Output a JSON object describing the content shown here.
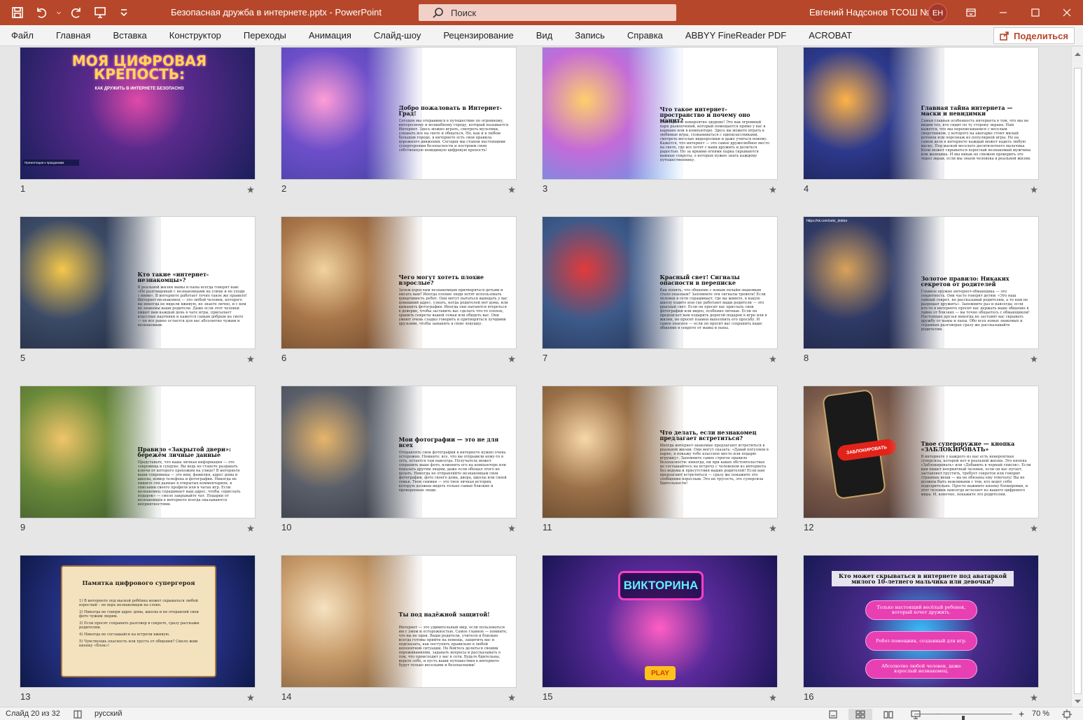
{
  "titlebar": {
    "doc_title": "Безопасная дружба в интернете.pptx  -  PowerPoint",
    "search_placeholder": "Поиск",
    "user_name": "Евгений Надсонов ТСОШ №2",
    "user_initials": "ЕН"
  },
  "ribbon": {
    "tabs": [
      "Файл",
      "Главная",
      "Вставка",
      "Конструктор",
      "Переходы",
      "Анимация",
      "Слайд-шоу",
      "Рецензирование",
      "Вид",
      "Запись",
      "Справка",
      "ABBYY FineReader PDF",
      "ACROBAT"
    ],
    "share_label": "Поделиться"
  },
  "slides": [
    {
      "num": "1",
      "kind": "cover",
      "title": "МОЯ ЦИФРОВАЯ КРЕПОСТЬ:",
      "subtitle": "КАК ДРУЖИТЬ В ИНТЕРНЕТЕ БЕЗОПАСНО",
      "footer": "Презентации к праздникам",
      "palette": [
        "#1b1f5c",
        "#5a2a8c",
        "#e04aa8"
      ]
    },
    {
      "num": "2",
      "kind": "text",
      "title": "Добро пожаловать в Интернет-Град!",
      "body": "Сегодня мы отправимся в путешествие по огромному, интересному и волшебному городу, который называется Интернет. Здесь можно играть, смотреть мультики, узнавать все на свете и общаться. Но, как и в любом большом городе, в интернете есть свои правила дорожного движения. Сегодня мы станем настоящими супергероями безопасности и построим свою собственную невидимую цифровую крепость!",
      "palette": [
        "#3a3f9a",
        "#6d4fc9",
        "#ff9dd6"
      ]
    },
    {
      "num": "3",
      "kind": "text",
      "title": "Что такое интернет-пространство и почему оно манит?",
      "body": "В интернете невероятно здорово! Это как огромный парк развлечений, который помещается прямо у вас в кармане или в компьютере. Здесь вы можете играть в любимые игры, созваниваться с одноклассниками, смотреть веселые видеоролики и даже учиться новому. Кажется, что интернет — это самое дружелюбное место на свете, где все хотят с вами дружить и делиться радостью. Но за яркими огнями парка скрываются важные секреты, о которых нужно знать каждому путешественнику.",
      "palette": [
        "#4aa3e8",
        "#c46bd8",
        "#ffcf6b"
      ]
    },
    {
      "num": "4",
      "kind": "text",
      "title": "Главная тайна интернета — маски и невидимки",
      "body": "Самая главная особенность интернета в том, что мы не видим тех, кто сидит по ту сторону экрана. Нам кажется, что мы переписываемся с веселым сверстником, у которого на аватарке стоит милый котенок или персонаж из популярной игры. Но на самом деле в интернете каждый может надеть любую маску. Под маской веселого десятилетнего мальчика Коли может скрываться взрослый незнакомый мужчина или женщина. И мы никак не сможем проверить это через экран, если мы знаем человека в реальной жизни.",
      "palette": [
        "#14183f",
        "#2d3a8c",
        "#ffb347"
      ]
    },
    {
      "num": "5",
      "kind": "text",
      "title": "Кто такие «интернет-незнакомцы»?",
      "body": "В реальной жизни мамы и папы всегда говорят нам: «Не разговаривай с незнакомцами на улице и не уходи с ними». В интернете работает точно такое же правило! Интернет-незнакомец — это любой человек, которого вы никогда не видели вживую, не знаете лично, и с кем не знакомы ваши родители. Даже если этот человек пишет вам каждый день в чате игры, присылает классные картинки и кажется самым добрым на свете — он все равно остается для вас абсолютно чужим и незнакомым.",
      "palette": [
        "#1c2333",
        "#3b4a66",
        "#f5c84a"
      ]
    },
    {
      "num": "6",
      "kind": "text",
      "title": "Чего могут хотеть плохие взрослые?",
      "body": "Зачем взрослым незнакомцам притворяться детьми и писать вам? Иногда плохие люди хотят использовать доверчивость ребят. Они могут пытаться выведать у вас домашний адрес, узнать, когда родителей нет дома, или выманить фотографии. Иногда они пытаются втереться в доверие, чтобы заставить вас сделать что-то плохое, хранить секреты вашей семьи или обидеть вас. Они умеют очень сладко говорить и притворяться лучшими друзьями, чтобы заманить в свою ловушку.",
      "palette": [
        "#5a3a22",
        "#a8764a",
        "#f2d2a0"
      ]
    },
    {
      "num": "7",
      "kind": "text",
      "title": "Красный свет! Сигналы опасности в переписке",
      "body": "Как понять, что общение с новым онлайн-знакомым стало опасным? Запомните эти сигналы тревоги! Если человек в сети спрашивает, где вы живете, в какую школу ходите или где работают ваши родители — это красный свет. Если он просит вас прислать свои фотографии или видео, особенно личные. Если он предлагает вам подарить дорогой подарок в игре или в жизни, но просит взамен выполнить его просьбу. И самое опасное — если он просит вас сохранить ваше общение в секрете от мамы и папы.",
      "palette": [
        "#1e2a4a",
        "#3d5a8a",
        "#e23a3a"
      ]
    },
    {
      "num": "8",
      "kind": "text",
      "title": "Золотое правило: Никаких секретов от родителей",
      "body": "Главное оружие интернет-обманщика — это секретность. Они часто говорят детям: «Это наш тайный секрет, не рассказывай родителям, а то нам не разрешат дружить». Запомните раз и навсегда: если кто-то в интернете просит вас держать ваше общение в тайне от близких — вы точно общаетесь с обманщиком! Настоящие друзья никогда не заставят вас скрывать дружбу от мамы и папы. Обо всех новых знакомых и странных разговорах сразу же рассказывайте родителям.",
      "url": "https://vk.com/sekr_doktor",
      "palette": [
        "#1a1f3a",
        "#2f3a66",
        "#d9a35a"
      ]
    },
    {
      "num": "9",
      "kind": "text",
      "title": "Правило «Закрытой двери»: бережём личные данные",
      "body": "Представьте, что ваша личная информация — это сокровища в сундуке. Вы ведь не станете раздавать ключи от которого прохожим на улице? В интернете ваши сокровища — это имя, фамилия, адрес дома и школы, номер телефона и фотографии. Никогда не пишите эти данные в открытых комментариях, в описании своего профиля или в чатах игр. Если незнакомец спрашивает ваш адрес, чтобы «прислать подарок» — смело закрывайте чат. Подарки от незнакомцев в интернете всегда оказываются неприятностями.",
      "palette": [
        "#2f4a2a",
        "#6b8a3a",
        "#f0c46a"
      ]
    },
    {
      "num": "10",
      "kind": "text",
      "title": "Мои фотографии — это не для всех",
      "body": "Отправлять свои фотографии в интернете нужно очень осторожно. Помните: все, что вы отправили кому-то в сеть, остается там навсегда. Получатель может сохранить ваше фото, изменить его на компьютере или показать другим людям, даже если обещал этого не делать. Никогда не отправляйте незнакомцам свои фотографии, фото своего дома, двора, школы или своей семьи. Твои снимки — это твоя личная история, которую должны видеть только самые близкие и проверенные люди.",
      "palette": [
        "#2a2f3a",
        "#5a5f6a",
        "#e7b56a"
      ]
    },
    {
      "num": "11",
      "kind": "text",
      "title": "Что делать, если незнакомец предлагает встретиться?",
      "body": "Иногда интернет-знакомые предлагают встретиться в реальной жизни. Они могут сказать: «Давай погуляем в парке, я покажу тебе классное место или подарю игрушку». Запомните самое строгое правило безопасности: никогда, ни при каких обстоятельствах не соглашайтесь на встречу с человеком из интернета без ведома и присутствия ваших родителей! Если вам предлагают встретиться — сразу же покажите это сообщение взрослым. Это не трусость, это суперсила бдительности!",
      "palette": [
        "#4a3422",
        "#9a7048",
        "#f7d7a8"
      ]
    },
    {
      "num": "12",
      "kind": "phone",
      "title": "Твое супероружие — кнопка «ЗАБЛОКИРОВАТЬ»",
      "body": "В интернете у каждого из нас есть невероятная суперсила, которой нет в реальной жизни. Это кнопка «Заблокировать» или «Добавить в черный список». Если вам пишет неприятный человек, если он вас пугает, заставляет грустить, требует секретов или говорит странные вещи — вы не обязаны ему отвечать! Вы не должны быть вежливыми с тем, кто ведет себя подозрительно. Просто нажмите кнопку блокировки, и этот человек навсегда исчезнет из вашего цифрового мира. И, конечно, покажите это родителям.",
      "button": "ЗАБЛОКИРОВАТЬ",
      "palette": [
        "#3a2a2a",
        "#7a5a4a",
        "#c8a07a"
      ]
    },
    {
      "num": "13",
      "kind": "memo",
      "title": "Памятка цифрового супергероя",
      "items": [
        "1) В интернете под маской ребёнка может скрываться любой взрослый – не верь незнакомцам на слово.",
        "2) Никогда не говори адрес дома, школы и не отправляй свои фото чужим людям.",
        "3) Если просят сохранить разговор в секрете, сразу расскажи родителям.",
        "4) Никогда не соглашайся на встречи вживую.",
        "5) Чувствуешь опасность или грусть от общения? Смело жми кнопку «Блок»!"
      ],
      "palette": [
        "#0f1a4a",
        "#2f3a9a",
        "#5fe0ff"
      ]
    },
    {
      "num": "14",
      "kind": "text",
      "title": "Ты под надёжной защитой!",
      "body": "Интернет — это удивительный мир, если пользоваться им с умом и осторожностью. Самое главное — помните, что вы не одни. Ваши родители, учителя и близкие всегда готовы прийти на помощь, защитить вас и подсказать, как поступить правильно в любой непонятной ситуации. Не бойтесь делиться своими переживаниями, задавать вопросы и рассказывать о том, что происходит у вас в сети. Будьте бдительны, верьте себе, и пусть ваши путешествия в интернете будут только веселыми и безопасными!",
      "palette": [
        "#6a4a2a",
        "#c79a6a",
        "#f5e2c0"
      ]
    },
    {
      "num": "15",
      "kind": "quiz",
      "title": "ВИКТОРИНА",
      "play": "PLAY",
      "palette": [
        "#1a1555",
        "#5a2a9a",
        "#ff5ec4"
      ]
    },
    {
      "num": "16",
      "kind": "question",
      "title": "Кто может скрываться в интернете под аватаркой милого 10-летнего мальчика или девочки?",
      "options": [
        "Только настоящий весёлый ребенок, который хочет дружить.",
        "Робот-помощник, созданный для игр.",
        "Абсолютно любой человек, даже взрослый незнакомец."
      ],
      "palette": [
        "#171a55",
        "#4a2a8a",
        "#37c6ff"
      ]
    }
  ],
  "statusbar": {
    "slide_info": "Слайд 20 из 32",
    "language": "русский",
    "zoom": "70 %",
    "zoom_fraction": 0.5
  },
  "colors": {
    "accent": "#b7472a",
    "ribbon_bg": "#f3f3f3",
    "sorter_bg": "#e6e6e6"
  }
}
